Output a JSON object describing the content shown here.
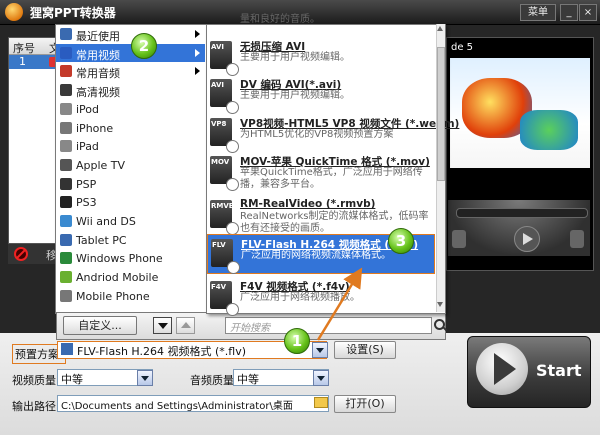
{
  "window": {
    "title": "狸窝PPT转换器",
    "menu_label": "菜单",
    "minimize": "_",
    "close": "×"
  },
  "file_list": {
    "columns": [
      "序号",
      "文"
    ],
    "row_number": "1",
    "remove_label": "移"
  },
  "preview": {
    "slide_label": "de 5"
  },
  "menu1": {
    "items": [
      {
        "label": "最近使用",
        "icon": "clock-icon"
      },
      {
        "label": "常用视频",
        "icon": "film-icon",
        "selected": true
      },
      {
        "label": "常用音频",
        "icon": "music-icon"
      },
      {
        "label": "高清视频",
        "icon": "hd-icon"
      },
      {
        "label": "iPod",
        "icon": "ipod-icon"
      },
      {
        "label": "iPhone",
        "icon": "iphone-icon"
      },
      {
        "label": "iPad",
        "icon": "ipad-icon"
      },
      {
        "label": "Apple TV",
        "icon": "appletv-icon"
      },
      {
        "label": "PSP",
        "icon": "psp-icon"
      },
      {
        "label": "PS3",
        "icon": "ps3-icon"
      },
      {
        "label": "Wii and DS",
        "icon": "wii-icon"
      },
      {
        "label": "Tablet PC",
        "icon": "tablet-icon"
      },
      {
        "label": "Windows Phone",
        "icon": "windows-phone-icon"
      },
      {
        "label": "Andriod Mobile",
        "icon": "android-icon"
      },
      {
        "label": "Mobile Phone",
        "icon": "mobile-phone-icon"
      }
    ],
    "custom_button": "自定义...",
    "search_placeholder": "开始搜索"
  },
  "menu2": {
    "items": [
      {
        "title": "",
        "desc": "量和良好的音质。",
        "icon_text": ""
      },
      {
        "title": "无损压缩 AVI",
        "desc": "主要用于用户视频编辑。",
        "icon_text": "AVI"
      },
      {
        "title": "DV 编码 AVI(*.avi)",
        "desc": "主要用于用户视频编辑。",
        "icon_text": "AVI"
      },
      {
        "title": "VP8视频-HTML5 VP8 视频文件 (*.webm)",
        "desc": "为HTML5优化的VP8视频预置方案",
        "icon_text": "VP8"
      },
      {
        "title": "MOV-苹果 QuickTime 格式 (*.mov)",
        "desc": "苹果QuickTime格式，广泛应用于网络传播，兼容多平台。",
        "icon_text": "MOV"
      },
      {
        "title": "RM-RealVideo (*.rmvb)",
        "desc": "RealNetworks制定的流媒体格式，低码率也有还接受的画质。",
        "icon_text": "RMVB"
      },
      {
        "title": "FLV-Flash H.264 视频格式 (*.flv)",
        "desc": "广泛应用的网络视频流媒体格式。",
        "icon_text": "FLV",
        "selected": true
      },
      {
        "title": "F4V 视频格式 (*.f4v)",
        "desc": "广泛应用于网络视频播放。",
        "icon_text": "F4V"
      }
    ]
  },
  "settings": {
    "preset_label": "预置方案:",
    "preset_value": "FLV-Flash H.264 视频格式 (*.flv)",
    "setup_button": "设置(S)",
    "video_quality_label": "视频质量:",
    "video_quality_value": "中等",
    "audio_quality_label": "音频质量:",
    "audio_quality_value": "中等",
    "output_label": "输出路径:",
    "output_value": "C:\\Documents and Settings\\Administrator\\桌面",
    "open_button": "打开(O)",
    "start_button": "Start"
  },
  "annotations": {
    "step1": "1",
    "step2": "2",
    "step3": "3"
  },
  "colors": {
    "selection": "#3374d8",
    "highlight_border": "#e07a20",
    "step_green": "#66c21a"
  }
}
